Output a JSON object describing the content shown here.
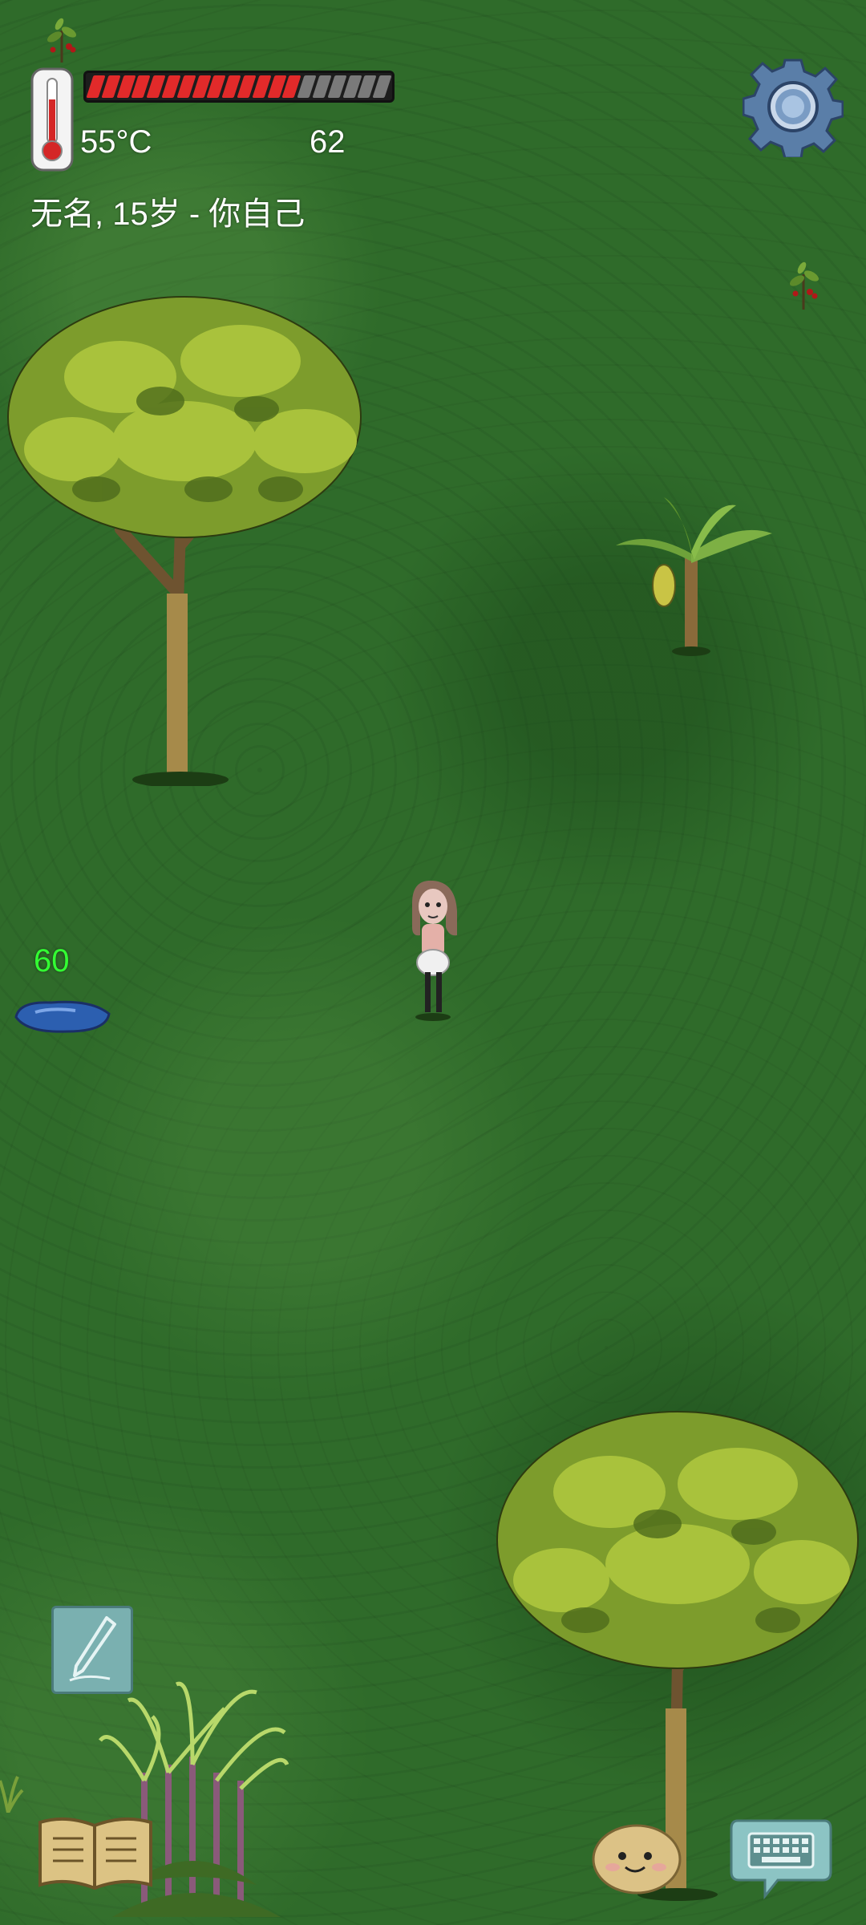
{
  "hud": {
    "temperature": "55°C",
    "food_value": "62",
    "identity": "无名, 15岁 - 你自己",
    "food_bar": {
      "total_pips": 20,
      "filled_pips": 14
    }
  },
  "world": {
    "pond_value": "60"
  },
  "colors": {
    "food_full": "#e22a2a",
    "food_empty": "#7a7a7a",
    "pond_value": "#33ff33",
    "grass": "#2f6b2a"
  },
  "icons": {
    "settings": "gear-icon",
    "thermometer": "thermometer-icon",
    "notes": "pencil-icon",
    "recipe_book": "book-icon",
    "emote": "potato-face-icon",
    "chat": "keyboard-icon"
  }
}
